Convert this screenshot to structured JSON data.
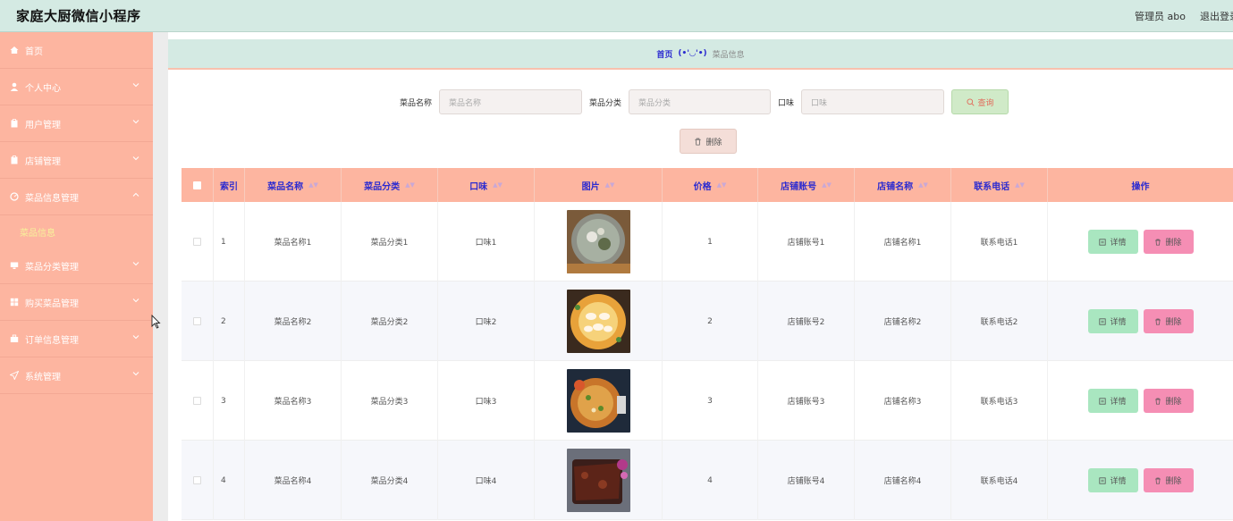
{
  "header": {
    "title": "家庭大厨微信小程序",
    "user_label": "管理员 abo",
    "logout_label": "退出登录"
  },
  "sidebar": {
    "items": [
      {
        "label": "首页",
        "icon": "home-icon"
      },
      {
        "label": "个人中心",
        "icon": "user-icon"
      },
      {
        "label": "用户管理",
        "icon": "clipboard-icon"
      },
      {
        "label": "店铺管理",
        "icon": "clipboard-icon"
      },
      {
        "label": "菜品信息管理",
        "icon": "gauge-icon",
        "expanded": true
      },
      {
        "label": "菜品分类管理",
        "icon": "monitor-icon"
      },
      {
        "label": "购买菜品管理",
        "icon": "grid-icon"
      },
      {
        "label": "订单信息管理",
        "icon": "briefcase-icon"
      },
      {
        "label": "系统管理",
        "icon": "send-icon"
      }
    ],
    "sub_active": "菜品信息"
  },
  "breadcrumb": {
    "home": "首页",
    "separator": "(•'◡'•)",
    "current": "菜品信息"
  },
  "search": {
    "name_label": "菜品名称",
    "name_placeholder": "菜品名称",
    "category_label": "菜品分类",
    "category_placeholder": "菜品分类",
    "taste_label": "口味",
    "taste_placeholder": "口味",
    "query_label": "查询",
    "delete_label": "删除"
  },
  "table": {
    "columns": [
      "索引",
      "菜品名称",
      "菜品分类",
      "口味",
      "图片",
      "价格",
      "店铺账号",
      "店铺名称",
      "联系电话",
      "操作"
    ],
    "rows": [
      {
        "index": "1",
        "name": "菜品名称1",
        "category": "菜品分类1",
        "taste": "口味1",
        "price": "1",
        "shop_account": "店铺账号1",
        "shop_name": "店铺名称1",
        "phone": "联系电话1"
      },
      {
        "index": "2",
        "name": "菜品名称2",
        "category": "菜品分类2",
        "taste": "口味2",
        "price": "2",
        "shop_account": "店铺账号2",
        "shop_name": "店铺名称2",
        "phone": "联系电话2"
      },
      {
        "index": "3",
        "name": "菜品名称3",
        "category": "菜品分类3",
        "taste": "口味3",
        "price": "3",
        "shop_account": "店铺账号3",
        "shop_name": "店铺名称3",
        "phone": "联系电话3"
      },
      {
        "index": "4",
        "name": "菜品名称4",
        "category": "菜品分类4",
        "taste": "口味4",
        "price": "4",
        "shop_account": "店铺账号4",
        "shop_name": "店铺名称4",
        "phone": "联系电话4"
      }
    ],
    "detail_label": "详情",
    "remove_label": "删除"
  }
}
